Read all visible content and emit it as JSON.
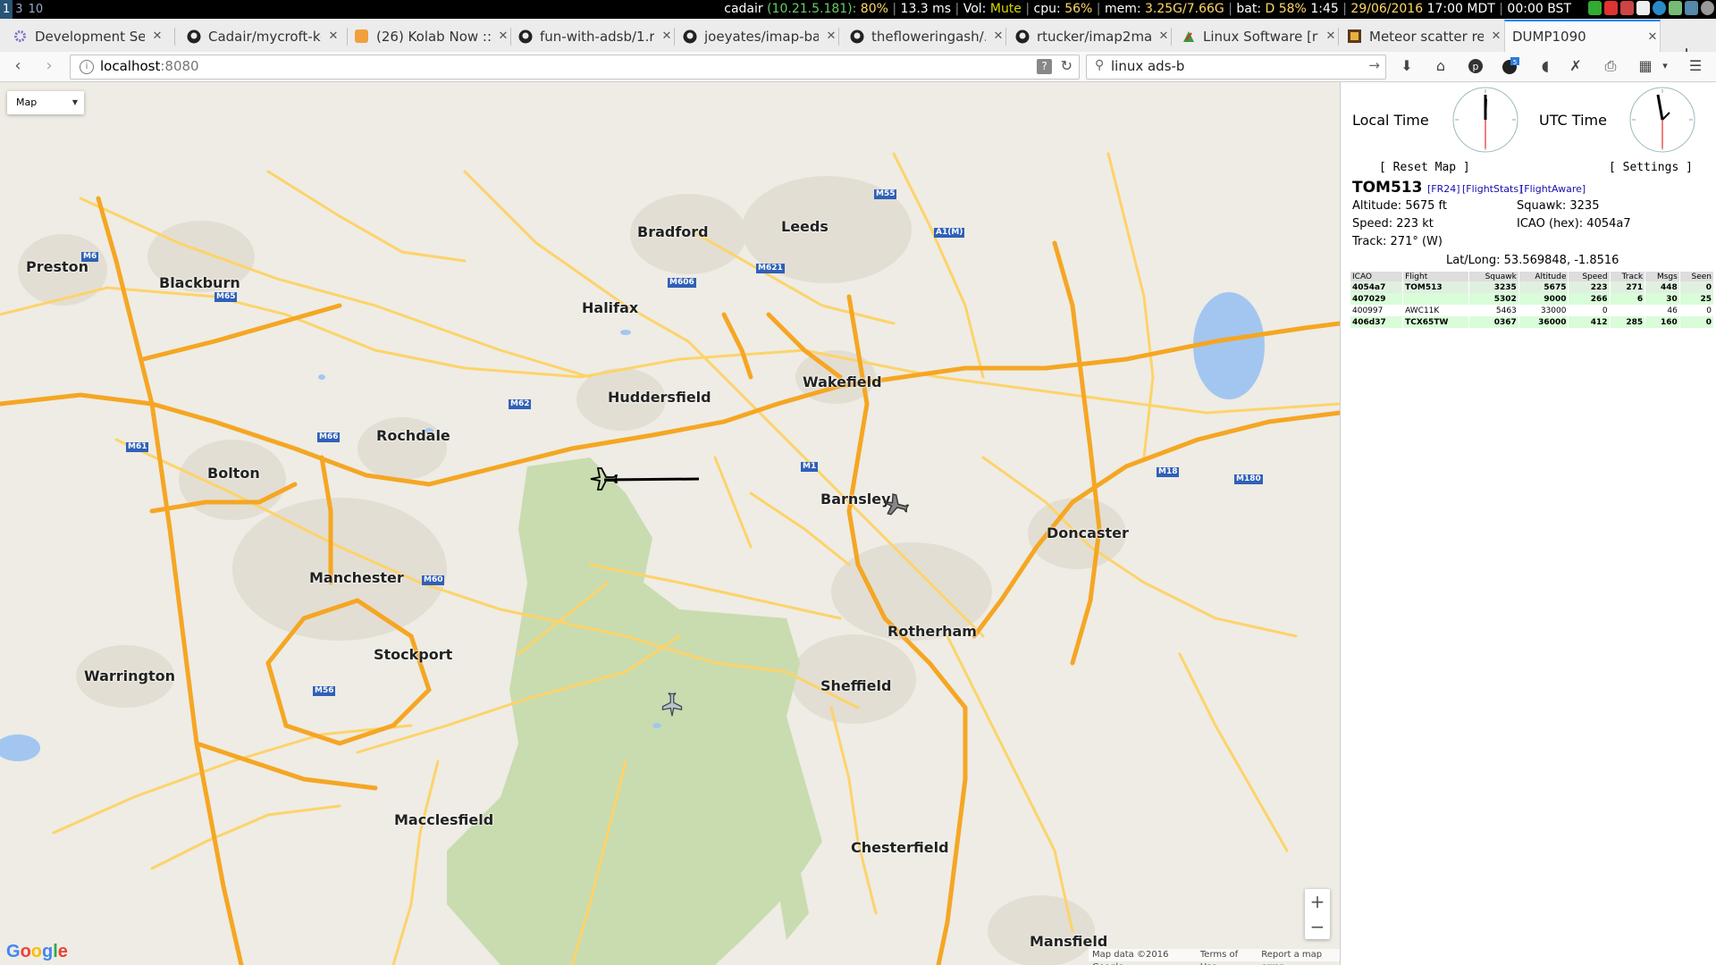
{
  "statusbar": {
    "workspaces": [
      "1",
      "3",
      "10"
    ],
    "host": "cadair",
    "ip": "(10.21.5.181):",
    "load": "80%",
    "ping": "13.3 ms",
    "vol_label": "Vol:",
    "vol_value": "Mute",
    "cpu_label": "cpu:",
    "cpu_value": "56%",
    "mem_label": "mem:",
    "mem_value": "3.25G/7.66G",
    "bat_label": "bat:",
    "bat_value": "D 58%",
    "bat_time": "1:45",
    "date": "29/06/2016",
    "time_local": "17:00 MDT",
    "time_bst": "00:00 BST"
  },
  "tabs": [
    {
      "title": "Development Set…",
      "icon": "gear-icon"
    },
    {
      "title": "Cadair/mycroft-ko…",
      "icon": "github-icon"
    },
    {
      "title": "(26) Kolab Now ::…",
      "icon": "kolab-icon"
    },
    {
      "title": "fun-with-adsb/1.r…",
      "icon": "github-icon"
    },
    {
      "title": "joeyates/imap-ba…",
      "icon": "github-icon"
    },
    {
      "title": "theflower­ingash/…",
      "icon": "github-icon"
    },
    {
      "title": "rtucker/imap2mail…",
      "icon": "github-icon"
    },
    {
      "title": "Linux Software [rt…",
      "icon": "software-icon"
    },
    {
      "title": "Meteor scatter re…",
      "icon": "meteor-icon"
    },
    {
      "title": "DUMP1090",
      "icon": ""
    }
  ],
  "navbar": {
    "url_host": "localhost",
    "url_port": ":8080",
    "search_text": "linux ads-b",
    "badge": "5"
  },
  "map": {
    "type_selector": "Map",
    "attribution": "Map data ©2016 Google",
    "terms": "Terms of Use",
    "report": "Report a map error",
    "logo": "Google",
    "zoom_in": "+",
    "zoom_out": "−",
    "towns_big": [
      "Leeds",
      "Bradford",
      "Preston",
      "Blackburn",
      "Halifax",
      "Huddersfield",
      "Wakefield",
      "Rochdale",
      "Bolton",
      "Manchester",
      "Barnsley",
      "Doncaster",
      "Rotherham",
      "Stockport",
      "Sheffield",
      "Warrington",
      "Chesterfield",
      "Macclesfield",
      "Mansfield"
    ],
    "roads": [
      "M62",
      "M1",
      "M6",
      "M60",
      "M61",
      "M65",
      "M66",
      "M18",
      "M180",
      "A1(M)",
      "M606",
      "M621",
      "M56",
      "M55"
    ]
  },
  "sidebar": {
    "local_time_label": "Local Time",
    "utc_time_label": "UTC Time",
    "reset_map": "[ Reset Map ]",
    "settings": "[ Settings ]",
    "selected": {
      "flight": "TOM513",
      "links": [
        "[FR24]",
        "[FlightStats]",
        "[FlightAware]"
      ],
      "altitude": "Altitude: 5675 ft",
      "squawk": "Squawk: 3235",
      "speed": "Speed: 223 kt",
      "icao": "ICAO (hex): 4054a7",
      "track": "Track: 271° (W)",
      "latlong": "Lat/Long: 53.569848, -1.8516"
    },
    "table": {
      "headers": [
        "ICAO",
        "Flight",
        "Squawk",
        "Altitude",
        "Speed",
        "Track",
        "Msgs",
        "Seen"
      ],
      "rows": [
        [
          "4054a7",
          "TOM513",
          "3235",
          "5675",
          "223",
          "271",
          "448",
          "0"
        ],
        [
          "407029",
          "",
          "5302",
          "9000",
          "266",
          "6",
          "30",
          "25"
        ],
        [
          "400997",
          "AWC11K",
          "5463",
          "33000",
          "0",
          "",
          "46",
          "0"
        ],
        [
          "406d37",
          "TCX65TW",
          "0367",
          "36000",
          "412",
          "285",
          "160",
          "0"
        ]
      ]
    }
  },
  "colors": {
    "motorway": "#f5a623",
    "a_road": "#fdd36a",
    "park": "#c8dcb0",
    "water": "#a3c6f0",
    "urban": "#e4e0d6",
    "tab_accent": "#0a84ff"
  }
}
